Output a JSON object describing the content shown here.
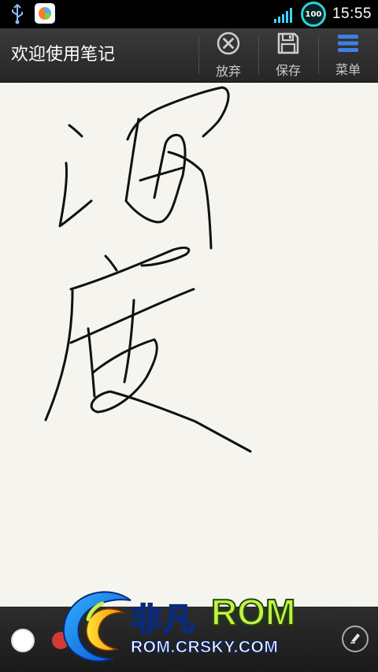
{
  "status_bar": {
    "time": "15:55",
    "battery_level": "100",
    "icons": [
      "usb-icon",
      "app-notification-icon",
      "signal-icon",
      "battery-icon"
    ]
  },
  "action_bar": {
    "title": "欢迎使用笔记",
    "discard_label": "放弃",
    "save_label": "保存",
    "menu_label": "菜单"
  },
  "bottom_bar": {
    "colors": [
      "#ffffff",
      "#d23a3a"
    ],
    "eraser_icon": "eraser-icon"
  },
  "watermark": {
    "brand_cn": "非凡",
    "brand_rom": "ROM",
    "url": "ROM.CRSKY.COM"
  },
  "colors": {
    "canvas_bg": "#f6f5f0",
    "ink": "#111111",
    "action_bar_bg": "#2e2e2e",
    "accent_blue": "#3f7fe6"
  }
}
